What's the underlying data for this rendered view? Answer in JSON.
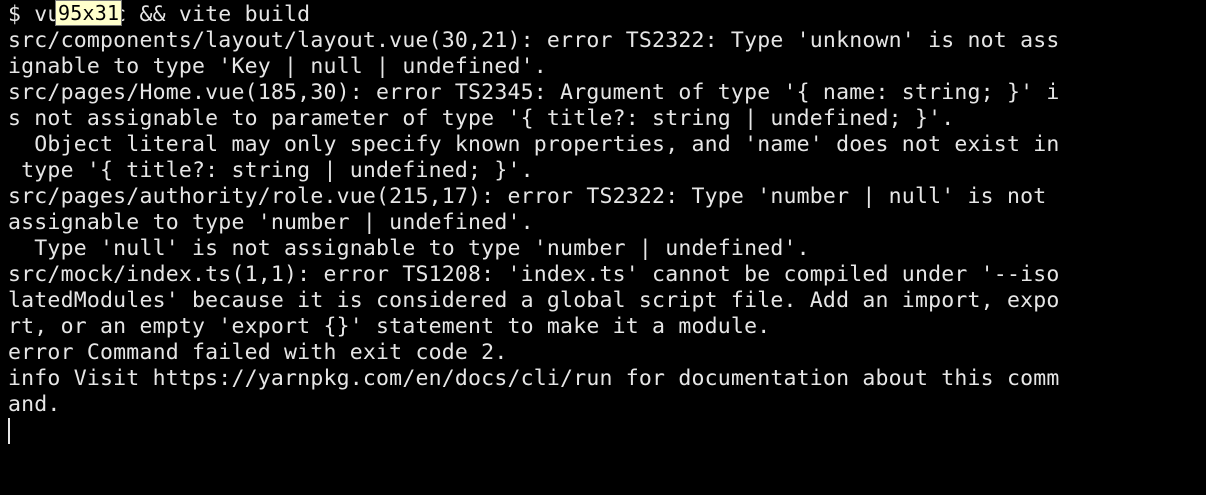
{
  "terminal": {
    "lines": [
      "$ vue-tsc && vite build",
      "src/components/layout/layout.vue(30,21): error TS2322: Type 'unknown' is not ass",
      "ignable to type 'Key | null | undefined'.",
      "src/pages/Home.vue(185,30): error TS2345: Argument of type '{ name: string; }' i",
      "s not assignable to parameter of type '{ title?: string | undefined; }'.",
      "  Object literal may only specify known properties, and 'name' does not exist in",
      " type '{ title?: string | undefined; }'.",
      "src/pages/authority/role.vue(215,17): error TS2322: Type 'number | null' is not",
      "assignable to type 'number | undefined'.",
      "  Type 'null' is not assignable to type 'number | undefined'.",
      "src/mock/index.ts(1,1): error TS1208: 'index.ts' cannot be compiled under '--iso",
      "latedModules' because it is considered a global script file. Add an import, expo",
      "rt, or an empty 'export {}' statement to make it a module.",
      "error Command failed with exit code 2.",
      "info Visit https://yarnpkg.com/en/docs/cli/run for documentation about this comm",
      "and."
    ],
    "size_badge": "95x31"
  },
  "colors": {
    "background": "#000000",
    "foreground": "#e6e6e6",
    "badge_background": "#ffffcc"
  }
}
